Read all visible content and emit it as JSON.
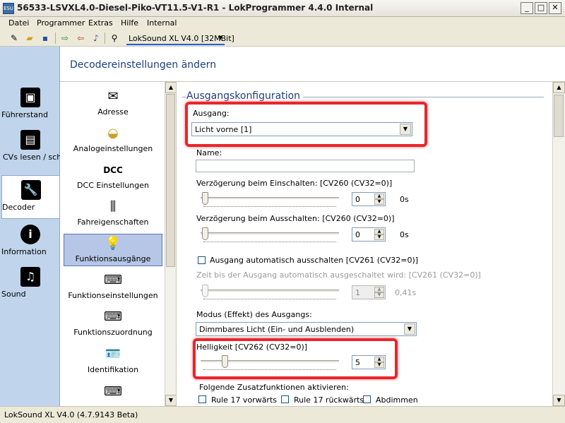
{
  "window": {
    "title": "56533-LSVXL4.0-Diesel-Piko-VT11.5-V1-R1 - LokProgrammer 4.4.0 Internal",
    "app_icon_text": "ESU",
    "min_glyph": "_",
    "max_glyph": "□",
    "close_glyph": "✕"
  },
  "menu": [
    "Datei",
    "Programmer",
    "Extras",
    "Hilfe",
    "Internal"
  ],
  "toolbar": {
    "decoder_select": "LokSound XL V4.0 [32MBit]",
    "icons": [
      "new-icon",
      "open-icon",
      "save-icon",
      "import-icon",
      "export-icon",
      "sound-icon",
      "probe-icon"
    ]
  },
  "nav": {
    "items": [
      {
        "label": "Führerstand",
        "icon": "cab-icon",
        "glyph": "▣"
      },
      {
        "label": "CVs lesen / schreiben",
        "icon": "cv-icon",
        "glyph": "▤"
      },
      {
        "label": "Decoder",
        "icon": "wrench-icon",
        "glyph": "🔧",
        "active": true
      },
      {
        "label": "Information",
        "icon": "info-icon",
        "glyph": "i"
      },
      {
        "label": "Sound",
        "icon": "music-icon",
        "glyph": "♫"
      }
    ]
  },
  "main": {
    "header": "Decodereinstellungen ändern"
  },
  "functions": {
    "items": [
      {
        "label": "Adresse",
        "icon": "envelope-icon",
        "glyph": "✉"
      },
      {
        "label": "Analogeinstellungen",
        "icon": "gauge-icon",
        "glyph": "◒"
      },
      {
        "label": "DCC Einstellungen",
        "icon": "dcc-icon",
        "glyph": "DCC"
      },
      {
        "label": "Fahreigenschaften",
        "icon": "sliders-icon",
        "glyph": "⫼"
      },
      {
        "label": "Funktionsausgänge",
        "icon": "bulb-icon",
        "glyph": "💡",
        "active": true
      },
      {
        "label": "Funktionseinstellungen",
        "icon": "function-keys-icon",
        "glyph": "⌨"
      },
      {
        "label": "Funktionszuordnung",
        "icon": "function-map-icon",
        "glyph": "⌨"
      },
      {
        "label": "Identifikation",
        "icon": "id-card-icon",
        "glyph": "🪪"
      },
      {
        "label": "",
        "icon": "function-keys-icon",
        "glyph": "⌨"
      }
    ]
  },
  "settings": {
    "section_title": "Ausgangskonfiguration",
    "output_label": "Ausgang:",
    "output_value": "Licht vorne [1]",
    "name_label": "Name:",
    "name_value": "",
    "delay_on_label": "Verzögerung beim Einschalten: [CV260 (CV32=0)]",
    "delay_on_value": "0",
    "delay_on_unit": "0s",
    "delay_on_level": 0,
    "delay_off_label": "Verzögerung beim Ausschalten: [CV260 (CV32=0)]",
    "delay_off_value": "0",
    "delay_off_unit": "0s",
    "delay_off_level": 0,
    "auto_off_label": "Ausgang automatisch ausschalten [CV261 (CV32=0)]",
    "auto_off_checked": false,
    "auto_off_time_label": "Zeit bis der Ausgang automatisch ausgeschaltet wird: [CV261 (CV32=0)]",
    "auto_off_time_value": "1",
    "auto_off_time_unit": "0,41s",
    "mode_label": "Modus (Effekt) des Ausgangs:",
    "mode_value": "Dimmbares Licht (Ein- und Ausblenden)",
    "brightness_label": "Helligkeit [CV262 (CV32=0)]",
    "brightness_value": "5",
    "brightness_level_of_31": 5,
    "extra_label": "Folgende Zusatzfunktionen aktivieren:",
    "extras": [
      {
        "label": "Rule 17 vorwärts",
        "checked": false
      },
      {
        "label": "Rule 17 rückwärts",
        "checked": false
      },
      {
        "label": "Abdimmen",
        "checked": false
      }
    ],
    "highlight_color": "#e8262d"
  },
  "status": {
    "text": "LokSound XL V4.0 (4.7.9143 Beta)"
  }
}
